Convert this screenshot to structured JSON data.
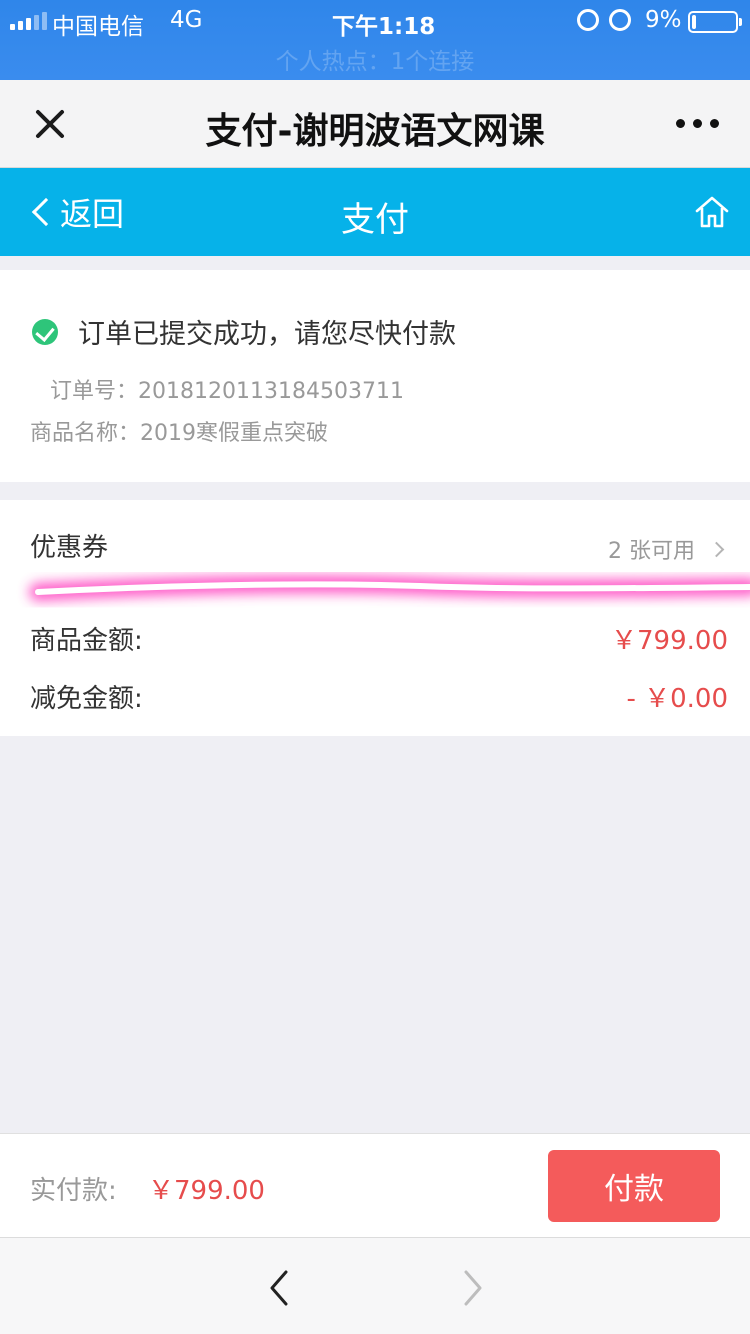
{
  "status_bar": {
    "carrier": "中国电信",
    "network": "4G",
    "time": "下午1:18",
    "battery_percent": "9%",
    "battery_level": 0.09,
    "hotspot_text": "个人热点：1个连接"
  },
  "wechat_nav": {
    "title": "支付-谢明波语文网课"
  },
  "page_header": {
    "back_label": "返回",
    "title": "支付"
  },
  "order": {
    "success_message": "订单已提交成功，请您尽快付款",
    "order_no": "订单号：2018120113184503711",
    "product_name": "商品名称：2019寒假重点突破"
  },
  "amounts": {
    "coupon_label": "优惠券",
    "coupon_available": "2 张可用",
    "goods_amount_label": "商品金额:",
    "goods_amount_value": "￥799.00",
    "discount_label": "减免金额:",
    "discount_value": "- ￥0.00"
  },
  "pay_bar": {
    "actual_label": "实付款:",
    "actual_value": "￥799.00",
    "pay_button": "付款"
  },
  "colors": {
    "status_bar": "#3a8cee",
    "header": "#06b2e9",
    "price": "#e64c4c",
    "pay_button": "#f45b5b",
    "success": "#2ec57a",
    "highlight": "#ff3fbf"
  },
  "icons": {
    "close": "close-icon",
    "more": "more-icon",
    "back": "chevron-left-icon",
    "home": "home-icon",
    "success": "check-circle-icon",
    "coupon_arrow": "chevron-right-icon",
    "browser_back": "chevron-left-icon",
    "browser_forward": "chevron-right-icon"
  }
}
